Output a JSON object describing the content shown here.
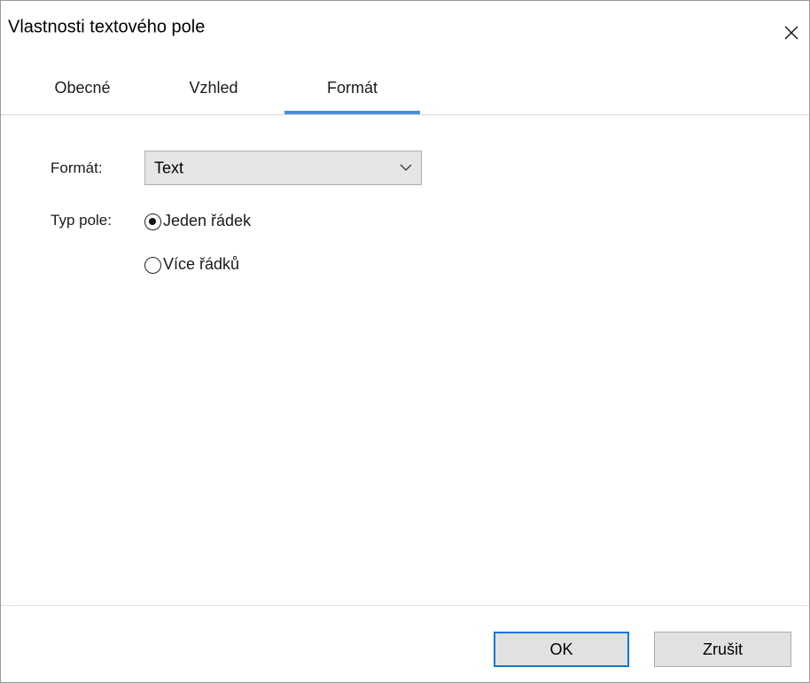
{
  "window": {
    "title": "Vlastnosti textového pole",
    "close_icon": "close-icon"
  },
  "tabs": [
    {
      "label": "Obecné",
      "active": false
    },
    {
      "label": "Vzhled",
      "active": false
    },
    {
      "label": "Formát",
      "active": true
    }
  ],
  "form": {
    "format_label": "Formát:",
    "format_value": "Text",
    "field_type_label": "Typ pole:",
    "radio_options": [
      {
        "label": "Jeden řádek",
        "checked": true
      },
      {
        "label": "Více řádků",
        "checked": false
      }
    ]
  },
  "buttons": {
    "ok_label": "OK",
    "cancel_label": "Zrušit"
  },
  "colors": {
    "accent": "#0078d7",
    "tab_indicator": "#4a90d9",
    "button_bg": "#e1e1e1"
  }
}
